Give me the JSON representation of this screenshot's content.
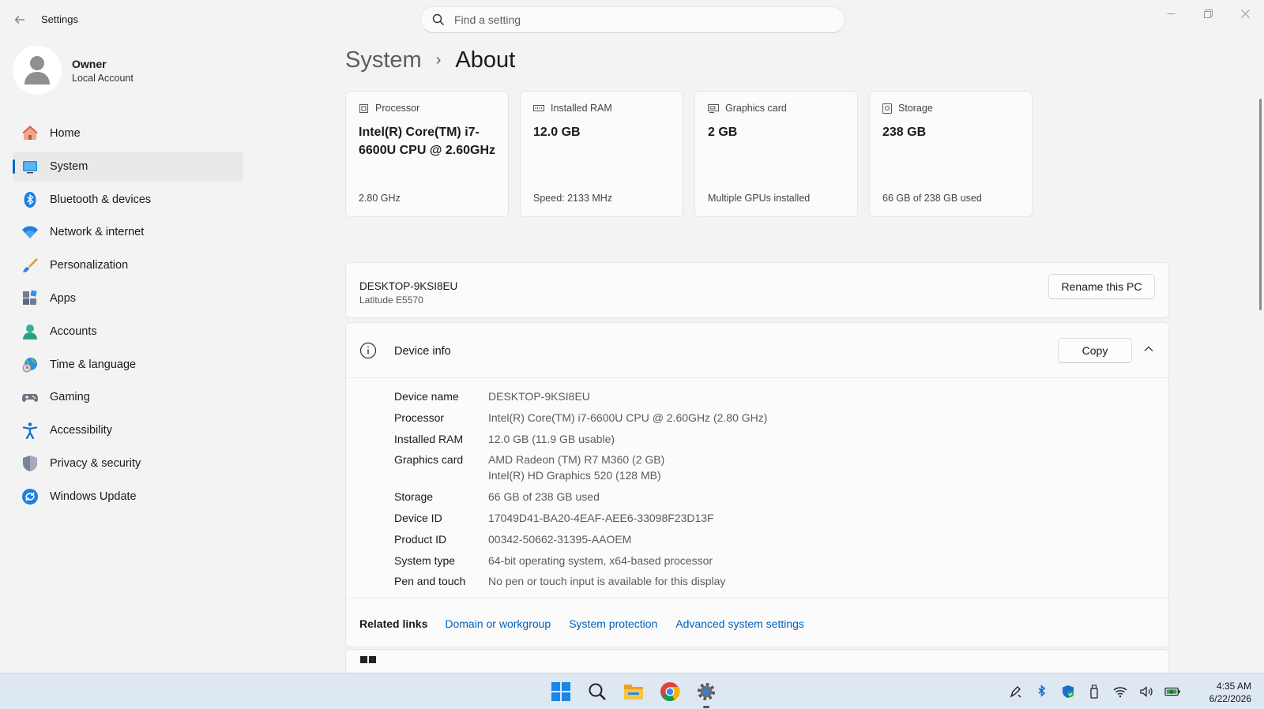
{
  "window": {
    "title": "Settings"
  },
  "search": {
    "placeholder": "Find a setting"
  },
  "profile": {
    "name": "Owner",
    "account_type": "Local Account"
  },
  "sidebar": {
    "items": [
      {
        "label": "Home",
        "icon": "home-icon"
      },
      {
        "label": "System",
        "icon": "system-icon",
        "active": true
      },
      {
        "label": "Bluetooth & devices",
        "icon": "bluetooth-icon"
      },
      {
        "label": "Network & internet",
        "icon": "wifi-icon"
      },
      {
        "label": "Personalization",
        "icon": "brush-icon"
      },
      {
        "label": "Apps",
        "icon": "apps-icon"
      },
      {
        "label": "Accounts",
        "icon": "accounts-icon"
      },
      {
        "label": "Time & language",
        "icon": "globe-clock-icon"
      },
      {
        "label": "Gaming",
        "icon": "gamepad-icon"
      },
      {
        "label": "Accessibility",
        "icon": "accessibility-icon"
      },
      {
        "label": "Privacy & security",
        "icon": "shield-icon"
      },
      {
        "label": "Windows Update",
        "icon": "update-icon"
      }
    ]
  },
  "breadcrumb": {
    "parent": "System",
    "separator": "›",
    "current": "About"
  },
  "spec_cards": [
    {
      "title": "Processor",
      "value": "Intel(R) Core(TM) i7-6600U CPU @ 2.60GHz",
      "footer": "2.80 GHz",
      "icon": "processor-icon"
    },
    {
      "title": "Installed RAM",
      "value": "12.0 GB",
      "footer": "Speed: 2133 MHz",
      "icon": "ram-icon"
    },
    {
      "title": "Graphics card",
      "value": "2 GB",
      "footer": "Multiple GPUs installed",
      "icon": "graphics-card-icon"
    },
    {
      "title": "Storage",
      "value": "238 GB",
      "footer": "66 GB of 238 GB used",
      "icon": "storage-icon"
    }
  ],
  "pc": {
    "name": "DESKTOP-9KSI8EU",
    "model": "Latitude E5570",
    "rename_label": "Rename this PC"
  },
  "device_info": {
    "title": "Device info",
    "copy_label": "Copy",
    "rows": [
      {
        "label": "Device name",
        "value": "DESKTOP-9KSI8EU"
      },
      {
        "label": "Processor",
        "value": "Intel(R) Core(TM) i7-6600U CPU @ 2.60GHz (2.80 GHz)"
      },
      {
        "label": "Installed RAM",
        "value": "12.0 GB (11.9 GB usable)"
      },
      {
        "label": "Graphics card",
        "value": "AMD Radeon (TM) R7 M360 (2 GB)",
        "value2": "Intel(R) HD Graphics 520 (128 MB)"
      },
      {
        "label": "Storage",
        "value": "66 GB of 238 GB used"
      },
      {
        "label": "Device ID",
        "value": "17049D41-BA20-4EAF-AEE6-33098F23D13F"
      },
      {
        "label": "Product ID",
        "value": "00342-50662-31395-AAOEM"
      },
      {
        "label": "System type",
        "value": "64-bit operating system, x64-based processor"
      },
      {
        "label": "Pen and touch",
        "value": "No pen or touch input is available for this display"
      }
    ]
  },
  "related_links": {
    "title": "Related links",
    "links": [
      "Domain or workgroup",
      "System protection",
      "Advanced system settings"
    ]
  },
  "taskbar": {
    "time": "4:35 AM",
    "date": "6/22/2026",
    "apps": [
      "windows-start-icon",
      "search-icon",
      "file-explorer-icon",
      "chrome-icon",
      "settings-gear-icon"
    ]
  },
  "colors": {
    "accent": "#0067c0",
    "link": "#0060b8",
    "background": "#f3f3f3",
    "card": "#fbfbfb"
  }
}
